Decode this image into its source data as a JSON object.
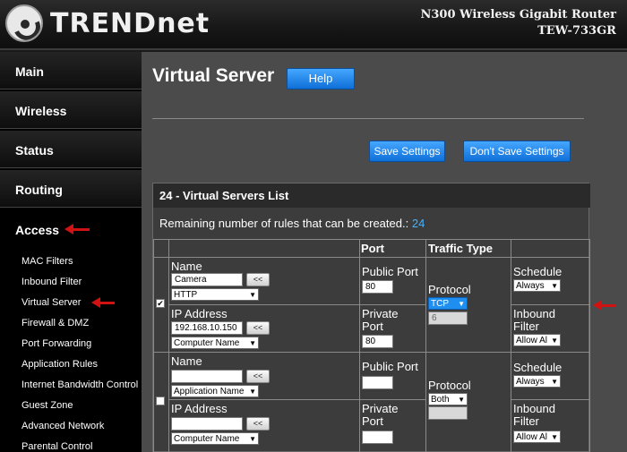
{
  "header": {
    "brand": "TRENDnet",
    "product_line1": "N300 Wireless Gigabit Router",
    "product_line2": "TEW-733GR"
  },
  "sidebar": {
    "main_items": [
      "Main",
      "Wireless",
      "Status",
      "Routing",
      "Access"
    ],
    "active": "Access",
    "sub_items": [
      "MAC Filters",
      "Inbound Filter",
      "Virtual Server",
      "Firewall & DMZ",
      "Port Forwarding",
      "Application Rules",
      "Internet Bandwidth Control",
      "Guest Zone",
      "Advanced Network",
      "Parental Control"
    ]
  },
  "page": {
    "title": "Virtual Server",
    "help_label": "Help",
    "save_label": "Save Settings",
    "dont_save_label": "Don't Save Settings"
  },
  "list": {
    "title": "24 - Virtual Servers List",
    "remaining_text": "Remaining number of rules that can be created.:",
    "remaining_count": "24",
    "col_port": "Port",
    "col_traffic": "Traffic Type",
    "name_label": "Name",
    "ip_label": "IP Address",
    "public_port_label": "Public Port",
    "private_port_label": "Private Port",
    "protocol_label": "Protocol",
    "schedule_label": "Schedule",
    "inbound_label": "Inbound Filter",
    "copy_btn": "<<",
    "rows": [
      {
        "checked": true,
        "name_value": "Camera",
        "app_select": "HTTP",
        "ip_value": "192.168.10.150",
        "computer_select": "Computer Name",
        "public_port": "80",
        "private_port": "80",
        "protocol": "TCP",
        "protocol_num": "6",
        "schedule": "Always",
        "inbound": "Allow Al"
      },
      {
        "checked": false,
        "name_value": "",
        "app_select": "Application Name",
        "ip_value": "",
        "computer_select": "Computer Name",
        "public_port": "",
        "private_port": "",
        "protocol": "Both",
        "protocol_num": "",
        "schedule": "Always",
        "inbound": "Allow Al"
      }
    ]
  },
  "icons": {
    "logo": "trendnet-logo-icon",
    "arrow": "red-arrow-icon",
    "chevron": "chevron-down-icon"
  },
  "colors": {
    "accent_blue": "#1e8ef0",
    "annotation_red": "#d11212",
    "count_blue": "#42b4ff"
  }
}
